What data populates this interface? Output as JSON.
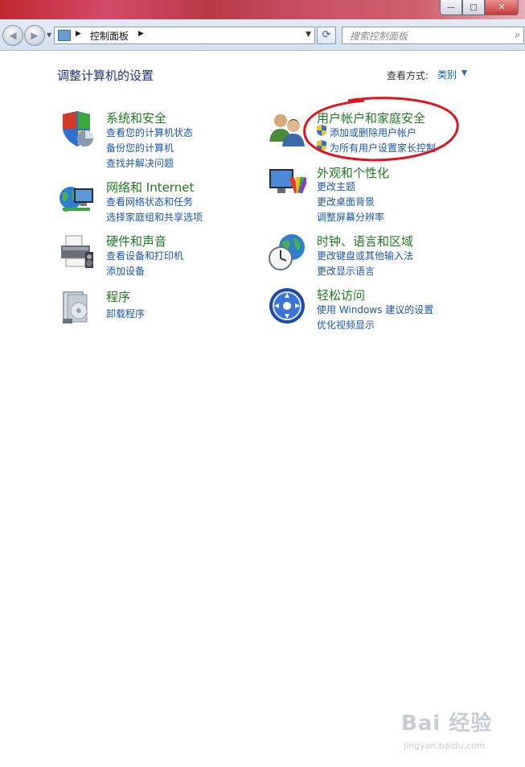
{
  "window": {
    "controls": {
      "minimize": "—",
      "maximize": "□",
      "close": "✕"
    }
  },
  "nav": {
    "back_glyph": "◀",
    "forward_glyph": "▶",
    "dropdown_glyph": "▼",
    "address": {
      "sep1": "▶",
      "path": "控制面板",
      "sep2": "▶",
      "dropdown": "▼"
    },
    "refresh_glyph": "⟳",
    "search": {
      "placeholder": "搜索控制面板",
      "icon_glyph": "⌕"
    }
  },
  "main": {
    "title": "调整计算机的设置",
    "view_by_label": "查看方式:",
    "view_by_value": "类别",
    "view_by_arrow": "▼"
  },
  "categories": [
    {
      "title": "系统和安全",
      "links": [
        "查看您的计算机状态",
        "备份您的计算机",
        "查找并解决问题"
      ]
    },
    {
      "title": "网络和 Internet",
      "links": [
        "查看网络状态和任务",
        "选择家庭组和共享选项"
      ]
    },
    {
      "title": "硬件和声音",
      "links": [
        "查看设备和打印机",
        "添加设备"
      ]
    },
    {
      "title": "程序",
      "links": [
        "卸载程序"
      ]
    },
    {
      "title": "用户帐户和家庭安全",
      "links": [
        "添加或删除用户帐户",
        "为所有用户设置家长控制"
      ]
    },
    {
      "title": "外观和个性化",
      "links": [
        "更改主题",
        "更改桌面背景",
        "调整屏幕分辨率"
      ]
    },
    {
      "title": "时钟、语言和区域",
      "links": [
        "更改键盘或其他输入法",
        "更改显示语言"
      ]
    },
    {
      "title": "轻松访问",
      "links": [
        "使用 Windows 建议的设置",
        "优化视频显示"
      ]
    }
  ],
  "watermark": {
    "main": "Bai 经验",
    "sub": "jingyan.baidu.com"
  },
  "colors": {
    "title_green": "#1e7a1e",
    "link_blue": "#1a56b0",
    "heading_navy": "#1e3287",
    "annotation_red": "#e0141e"
  }
}
